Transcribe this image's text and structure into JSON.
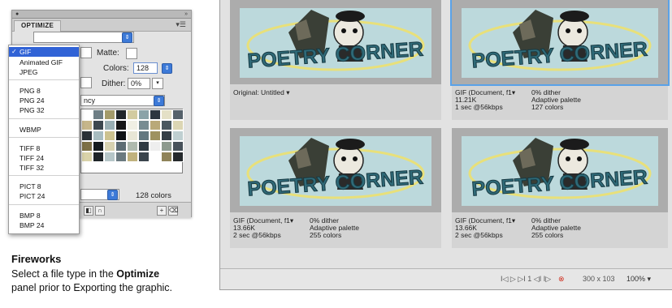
{
  "panel": {
    "tab_label": "OPTIMIZE",
    "matte_label": "Matte:",
    "colors_label": "Colors:",
    "colors_value": "128",
    "dither_label": "Dither:",
    "dither_value": "0%",
    "transparency_partial": "ncy",
    "colors_count": "128 colors"
  },
  "dropdown": {
    "items": [
      {
        "label": "GIF",
        "selected": true
      },
      {
        "label": "Animated GIF"
      },
      {
        "label": "JPEG"
      },
      {
        "label": "PNG 8"
      },
      {
        "label": "PNG 24"
      },
      {
        "label": "PNG 32"
      },
      {
        "label": "WBMP"
      },
      {
        "label": "TIFF 8"
      },
      {
        "label": "TIFF 24"
      },
      {
        "label": "TIFF 32"
      },
      {
        "label": "PICT 8"
      },
      {
        "label": "PICT 24"
      },
      {
        "label": "BMP 8"
      },
      {
        "label": "BMP 24"
      }
    ],
    "check": "✓"
  },
  "caption": {
    "heading": "Fireworks",
    "body_1": "Select a file type in the ",
    "body_bold": "Optimize",
    "body_2": "panel prior to Exporting the graphic."
  },
  "preview": {
    "logo_text": "POETRY CORNER",
    "panes": [
      {
        "col1": [
          "Original: Untitled ▾"
        ],
        "col2": []
      },
      {
        "col1": [
          "GIF (Document, f1▾",
          "11.21K",
          "1 sec @56kbps"
        ],
        "col2": [
          "0% dither",
          "Adaptive palette",
          "127 colors"
        ]
      },
      {
        "col1": [
          "GIF (Document, f1▾",
          "13.66K",
          "2 sec @56kbps"
        ],
        "col2": [
          "0% dither",
          "Adaptive palette",
          "255 colors"
        ]
      },
      {
        "col1": [
          "GIF (Document, f1▾",
          "13.66K",
          "2 sec @56kbps"
        ],
        "col2": [
          "0% dither",
          "Adaptive palette",
          "255 colors"
        ]
      }
    ],
    "status": {
      "controls": "I◁ ▷ ▷I 1 ◁I I▷",
      "dimensions": "300 x 103",
      "zoom": "100% ▾"
    }
  },
  "colors": {
    "selection": "#3163d6",
    "stepper": "#3d7ad8",
    "active_border": "#5aa2e8",
    "logo_teal": "#2f6a78",
    "logo_bg": "#bcd9dc",
    "ellipse": "#e8e07a"
  },
  "palette_colors": [
    "#ffffff",
    "#6e7f86",
    "#a39b6a",
    "#20262a",
    "#d2cba0",
    "#8aa3a8",
    "#2c3640",
    "#e4e0c6",
    "#56626b",
    "#c6b68a",
    "#3c474f",
    "#99aeb3",
    "#161616",
    "#f0efe4",
    "#788c92",
    "#b9a978",
    "#4a5860",
    "#dcd6b4",
    "#2a3138",
    "#a7bcc0",
    "#ccc28f",
    "#0f1215",
    "#e8e6d6",
    "#647880",
    "#9e9260",
    "#343e46",
    "#bfcfd1",
    "#7d7046",
    "#141a1d",
    "#d7d2b0",
    "#5d6d74",
    "#aeb9ae",
    "#2f3a42",
    "#eeeeee",
    "#8d9a8e",
    "#48525a",
    "#d9d2a9",
    "#1e2428",
    "#b6c6c8",
    "#6b7a80",
    "#c0b27e",
    "#3a444c",
    "#ffffff",
    "#8f8359",
    "#25292c"
  ]
}
